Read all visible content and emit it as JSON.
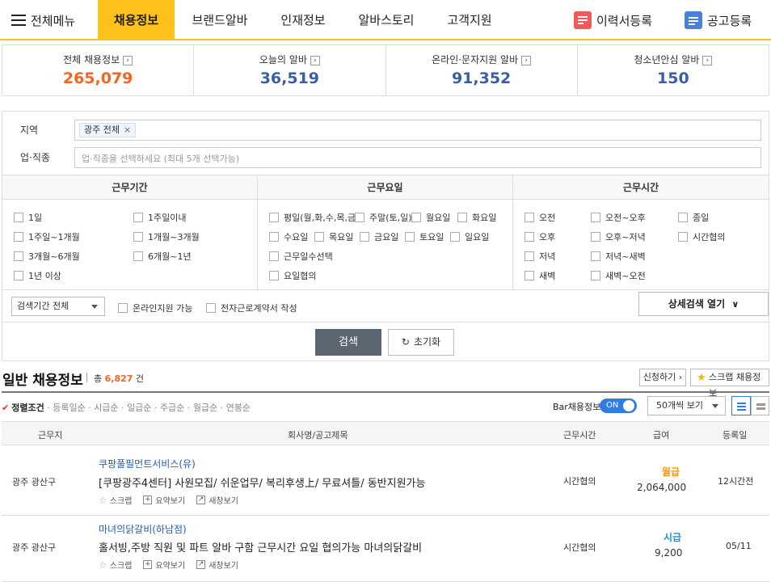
{
  "nav": {
    "menu_label": "전체메뉴",
    "tabs": [
      "채용정보",
      "브랜드알바",
      "인재정보",
      "알바스토리",
      "고객지원"
    ],
    "active_tab": "채용정보",
    "resume_label": "이력서등록",
    "post_label": "공고등록",
    "accent": "#ffc21a"
  },
  "stats": [
    {
      "label": "전체 채용정보",
      "value": "265,079",
      "color": "#f26522"
    },
    {
      "label": "오늘의 알바",
      "value": "36,519",
      "color": "#3b5ea8"
    },
    {
      "label": "온라인·문자지원 알바",
      "value": "91,352",
      "color": "#3b5ea8"
    },
    {
      "label": "청소년안심 알바",
      "value": "150",
      "color": "#3b5ea8"
    }
  ],
  "search": {
    "region_label": "지역",
    "region_chip": "광주 전체",
    "job_label": "업·직종",
    "job_placeholder": "업·직종을 선택하세요 (최대 5개 선택가능)",
    "period": {
      "header": "근무기간",
      "options": [
        "1일",
        "1주일이내",
        "1주일~1개월",
        "1개월~3개월",
        "3개월~6개월",
        "6개월~1년",
        "1년 이상"
      ]
    },
    "days": {
      "header": "근무요일",
      "options": [
        "평일(월,화,수,목,금)",
        "주말(토,일)",
        "월요일",
        "화요일",
        "수요일",
        "목요일",
        "금요일",
        "토요일",
        "일요일",
        "근무일수선택",
        "요일협의"
      ]
    },
    "hours": {
      "header": "근무시간",
      "options": [
        "오전",
        "오전~오후",
        "종일",
        "오후",
        "오후~저녁",
        "시간협의",
        "저녁",
        "저녁~새벽",
        "새벽",
        "새벽~오전"
      ]
    },
    "term_select": "검색기간 전체",
    "online_label": "온라인지원 가능",
    "econtract_label": "전자근로계약서 작성",
    "detail_label": "상세검색 열기",
    "search_btn": "검색",
    "reset_btn": "초기화"
  },
  "list": {
    "title": "일반 채용정보",
    "count_prefix": "총",
    "count": "6,827",
    "count_suffix": "건",
    "apply_btn": "신청하기",
    "scrap_btn": "스크랩 채용정보",
    "sort_options": [
      "정렬조건",
      "등록일순",
      "시급순",
      "일급순",
      "주급순",
      "월급순",
      "연봉순"
    ],
    "bar_label": "Bar채용정보",
    "toggle_state": "ON",
    "per_page": "50개씩 보기",
    "columns": [
      "근무지",
      "회사명/공고제목",
      "근무시간",
      "급여",
      "등록일"
    ],
    "actions": [
      "스크랩",
      "요약보기",
      "새창보기"
    ],
    "rows": [
      {
        "location": "광주 광산구",
        "company": "쿠팡풀필먼트서비스(유)",
        "title": "[쿠팡광주4센터] 사원모집/ 쉬운업무/ 복리후생上/ 무료셔틀/ 동반지원가능",
        "hours": "시간협의",
        "pay_type": "월급",
        "pay_color": "#f0941e",
        "pay": "2,064,000",
        "date": "12시간전"
      },
      {
        "location": "광주 광산구",
        "company": "마녀의닭갈비(하남점)",
        "title": "홀서빙,주방 직원 및 파트 알바 구함 근무시간 요일 협의가능 마녀의닭갈비",
        "hours": "시간협의",
        "pay_type": "시급",
        "pay_color": "#2a8fd6",
        "pay": "9,200",
        "date": "05/11"
      }
    ]
  }
}
